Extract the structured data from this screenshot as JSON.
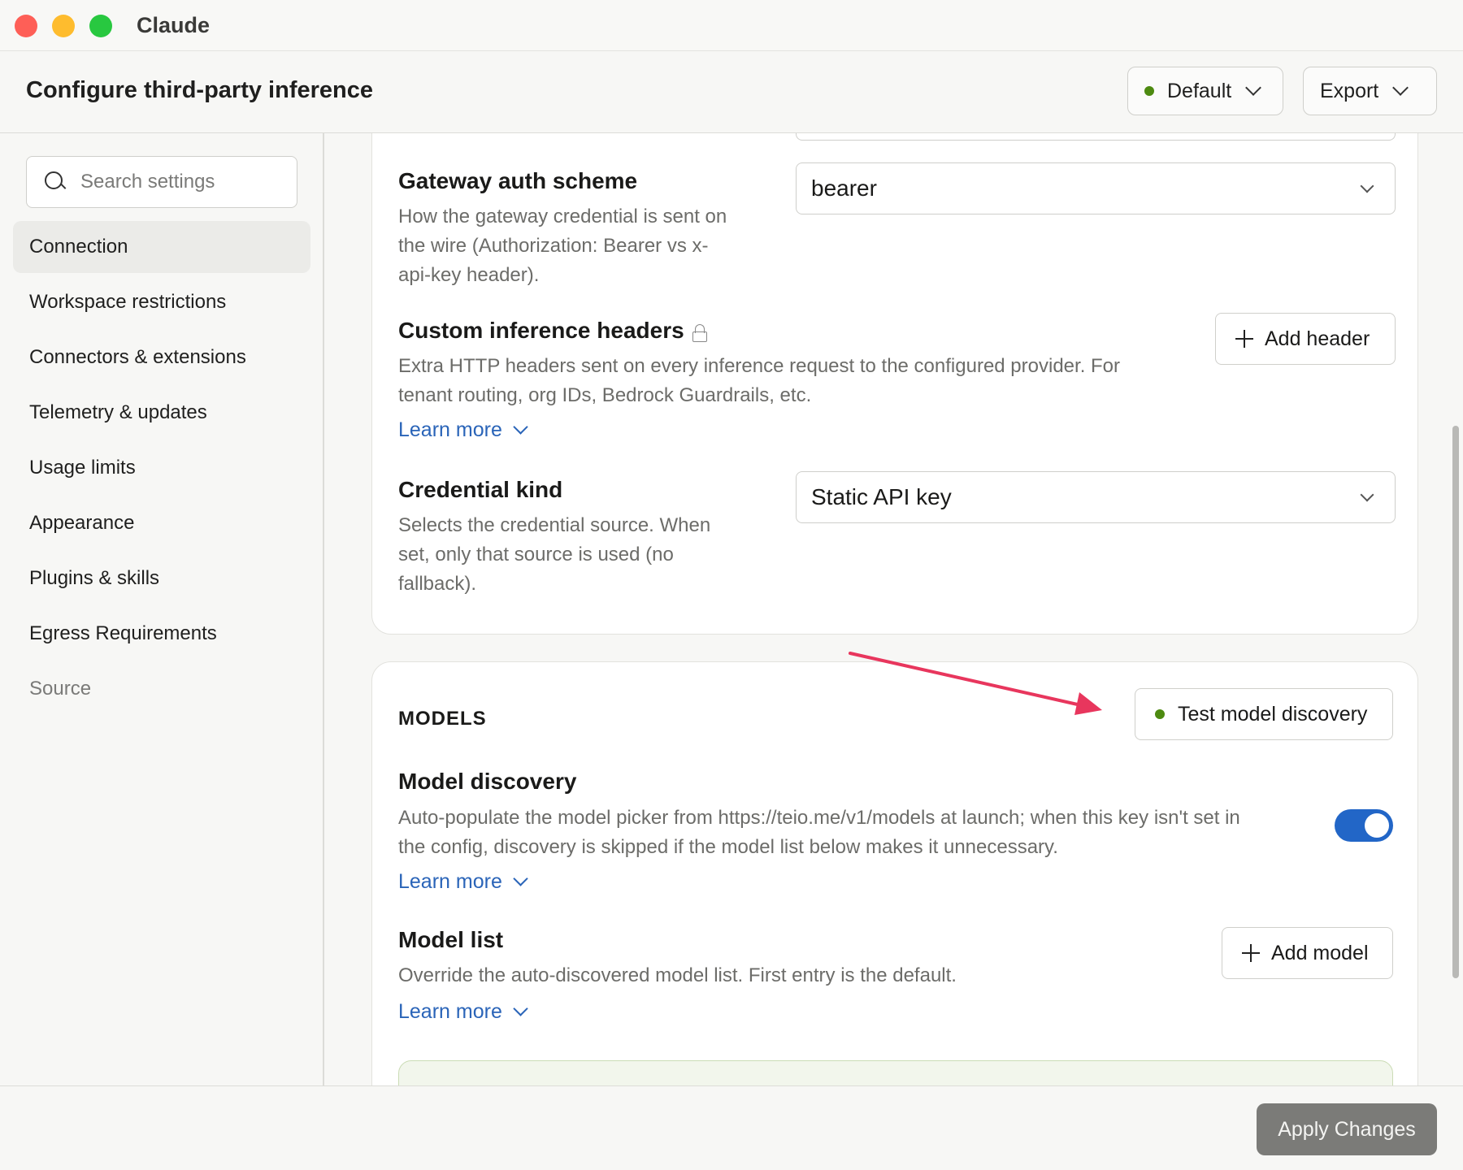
{
  "window": {
    "app_title": "Claude"
  },
  "header": {
    "title": "Configure third-party inference",
    "profile_label": "Default",
    "export_label": "Export"
  },
  "sidebar": {
    "search_placeholder": "Search settings",
    "items": [
      {
        "label": "Connection",
        "active": true
      },
      {
        "label": "Workspace restrictions"
      },
      {
        "label": "Connectors & extensions"
      },
      {
        "label": "Telemetry & updates"
      },
      {
        "label": "Usage limits"
      },
      {
        "label": "Appearance"
      },
      {
        "label": "Plugins & skills"
      },
      {
        "label": "Egress Requirements"
      },
      {
        "label": "Source",
        "muted": true
      }
    ]
  },
  "connection": {
    "gateway_auth": {
      "title": "Gateway auth scheme",
      "desc_lines": [
        "How the gateway credential is sent on",
        "the wire (Authorization: Bearer vs x-",
        "api-key header)."
      ],
      "value": "bearer"
    },
    "custom_headers": {
      "title": "Custom inference headers",
      "desc_lines": [
        "Extra HTTP headers sent on every inference request to the configured provider. For",
        "tenant routing, org IDs, Bedrock Guardrails, etc."
      ],
      "learn_more": "Learn more",
      "button": "Add header"
    },
    "credential_kind": {
      "title": "Credential kind",
      "desc_lines": [
        "Selects the credential source. When",
        "set, only that source is used (no",
        "fallback)."
      ],
      "value": "Static API key"
    }
  },
  "models": {
    "section_label": "MODELS",
    "test_button": "Test model discovery",
    "discovery": {
      "title": "Model discovery",
      "desc_lines": [
        "Auto-populate the model picker from https://teio.me/v1/models at launch; when this key isn't set in",
        "the config, discovery is skipped if the model list below makes it unnecessary."
      ],
      "learn_more": "Learn more",
      "enabled": true
    },
    "model_list": {
      "title": "Model list",
      "desc": "Override the auto-discovered model list. First entry is the default.",
      "learn_more": "Learn more",
      "button": "Add model"
    }
  },
  "footer": {
    "apply_label": "Apply Changes"
  },
  "colors": {
    "accent_blue": "#2266c7",
    "link_blue": "#2a64b8",
    "status_green": "#4d8a10",
    "annotation_arrow": "#e8365d"
  }
}
